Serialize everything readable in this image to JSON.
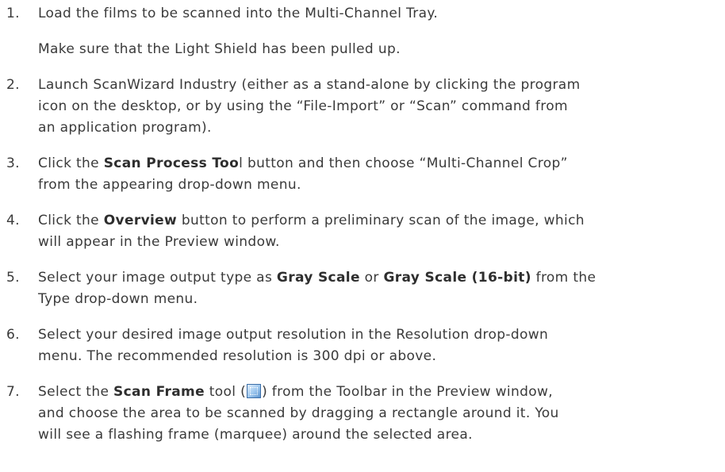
{
  "steps": [
    {
      "number": "1.",
      "lines": [
        "Load the films to be scanned into the Multi-Channel Tray."
      ],
      "note": "Make sure that the Light Shield has been pulled up."
    },
    {
      "number": "2.",
      "lines": [
        "Launch ScanWizard Industry (either as a stand-alone by clicking the program",
        "icon on the desktop, or by using the “File-Import” or “Scan” command from",
        "an application program)."
      ]
    },
    {
      "number": "3.",
      "line1_pre": "Click the ",
      "line1_bold": "Scan Process Too",
      "line1_post": "l button and then choose “Multi-Channel Crop”",
      "line2": "from the appearing drop-down menu."
    },
    {
      "number": "4.",
      "line1_pre": "Click the ",
      "line1_bold": "Overview",
      "line1_post": " button to perform a preliminary scan of the image, which",
      "line2": "will appear in the Preview window."
    },
    {
      "number": "5.",
      "line1_pre": "Select your image output type as ",
      "line1_bold1": "Gray Scale",
      "line1_mid": " or ",
      "line1_bold2": "Gray Scale (16-bit)",
      "line1_post": " from the",
      "line2": "Type drop-down menu."
    },
    {
      "number": "6.",
      "lines": [
        "Select your desired image output resolution in the Resolution drop-down",
        "menu.  The recommended resolution is 300 dpi or above."
      ]
    },
    {
      "number": "7.",
      "line1_pre": "Select the ",
      "line1_bold": "Scan Frame",
      "line1_mid": " tool (",
      "line1_post": ") from the Toolbar in the Preview window,",
      "icon": "scan-frame-icon",
      "line2": "and choose the area to be scanned by dragging a rectangle around it.  You",
      "line3": "will see a flashing frame (marquee) around the selected area."
    }
  ]
}
